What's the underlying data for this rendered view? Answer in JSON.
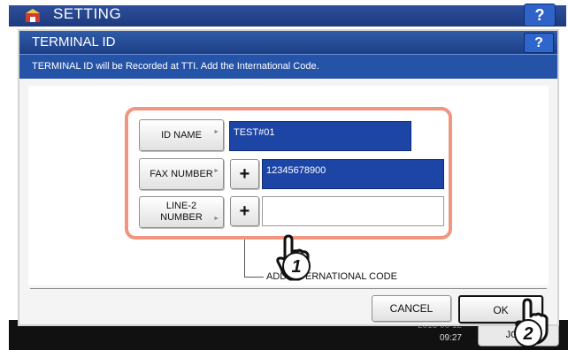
{
  "background": {
    "title": "SETTING",
    "help_label": "?",
    "time": "09:27",
    "jobs_label": "JOBS"
  },
  "dialog": {
    "title": "TERMINAL ID",
    "help_label": "?",
    "description": "TERMINAL ID will be Recorded at TTI. Add the International Code."
  },
  "form": {
    "rows": [
      {
        "label": "ID NAME",
        "value": "TEST#01"
      },
      {
        "label": "FAX NUMBER",
        "plus": "+",
        "value": "12345678900"
      },
      {
        "label_line1": "LINE-2",
        "label_line2": "NUMBER",
        "plus": "+",
        "value": ""
      }
    ],
    "add_code_label": "ADD INTERNATIONAL CODE"
  },
  "buttons": {
    "cancel": "CANCEL",
    "ok": "OK"
  },
  "callouts": [
    "1",
    "2"
  ],
  "colors": {
    "title_bar": "#1d3f86",
    "selected_field": "#1d45a6",
    "highlight_border": "#ef9580"
  }
}
